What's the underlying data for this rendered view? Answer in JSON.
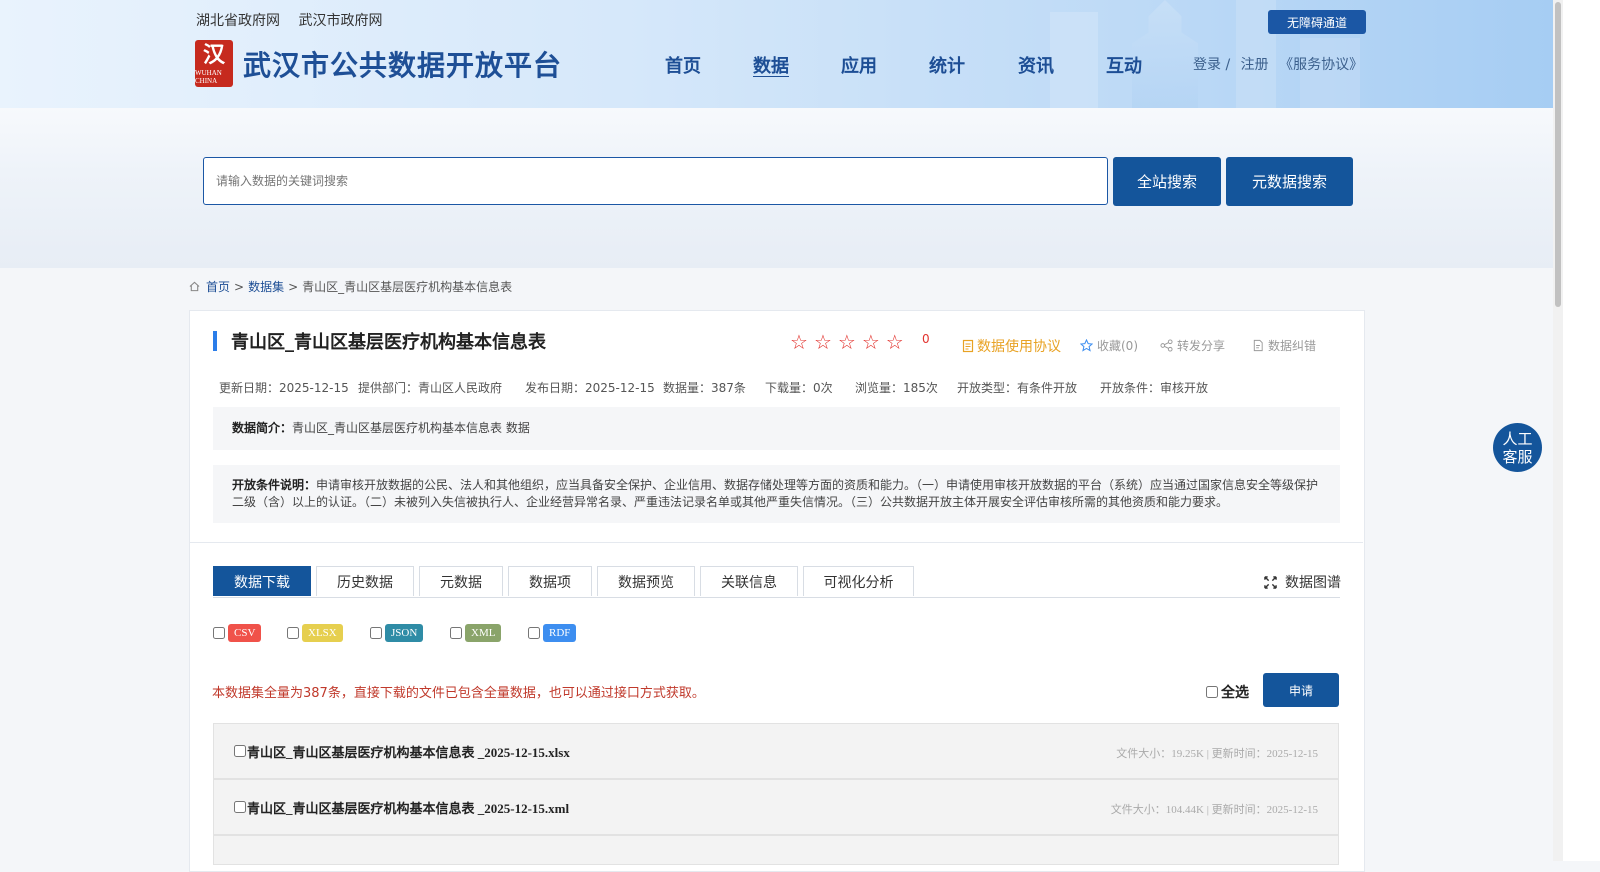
{
  "header": {
    "top_links": [
      "湖北省政府网",
      "武汉市政府网"
    ],
    "logo_text": "WUHAN CHINA",
    "site_title": "武汉市公共数据开放平台",
    "nav": [
      "首页",
      "数据",
      "应用",
      "统计",
      "资讯",
      "互动"
    ],
    "nav_active": "数据",
    "accessibility_button": "无障碍通道",
    "login": "登录 /",
    "register": "注册",
    "service_agreement": "《服务协议》"
  },
  "search": {
    "placeholder": "请输入数据的关键词搜索",
    "site_search": "全站搜索",
    "metadata_search": "元数据搜索"
  },
  "breadcrumb": {
    "home": "首页",
    "sep1": ">",
    "datasets": "数据集",
    "sep2": ">",
    "current": "青山区_青山区基层医疗机构基本信息表"
  },
  "dataset": {
    "title": "青山区_青山区基层医疗机构基本信息表",
    "rating": "0",
    "stars_total": 5,
    "usage_agreement": "数据使用协议",
    "favorite": "收藏(0)",
    "share": "转发分享",
    "report": "数据纠错",
    "meta": {
      "update_date": "更新日期：2025-12-15",
      "provider": "提供部门：青山区人民政府",
      "publish_date": "发布日期：2025-12-15",
      "data_count": "数据量：387条",
      "downloads": "下载量：0次",
      "views": "浏览量：185次",
      "open_type": "开放类型：有条件开放",
      "open_condition": "开放条件：审核开放"
    },
    "intro_label": "数据简介：",
    "intro_text": "青山区_青山区基层医疗机构基本信息表 数据",
    "condition_label": "开放条件说明：",
    "condition_text": "申请审核开放数据的公民、法人和其他组织，应当具备安全保护、企业信用、数据存储处理等方面的资质和能力。（一）申请使用审核开放数据的平台（系统）应当通过国家信息安全等级保护二级（含）以上的认证。（二）未被列入失信被执行人、企业经营异常名录、严重违法记录名单或其他严重失信情况。（三）公共数据开放主体开展安全评估审核所需的其他资质和能力要求。"
  },
  "tabs": [
    "数据下载",
    "历史数据",
    "元数据",
    "数据项",
    "数据预览",
    "关联信息",
    "可视化分析"
  ],
  "graph_link": "数据图谱",
  "formats": [
    {
      "label": "CSV",
      "color": "#f0524a"
    },
    {
      "label": "XLSX",
      "color": "#e6cf4f"
    },
    {
      "label": "JSON",
      "color": "#2f8ca6"
    },
    {
      "label": "XML",
      "color": "#8aa46a"
    },
    {
      "label": "RDF",
      "color": "#3d8ef0"
    }
  ],
  "download_note": "本数据集全量为387条，直接下载的文件已包含全量数据，也可以通过接口方式获取。",
  "select_all": "全选",
  "apply": "申请",
  "files": [
    {
      "name": "青山区_青山区基层医疗机构基本信息表 _2025-12-15.xlsx",
      "info": "文件大小：19.25K | 更新时间：2025-12-15"
    },
    {
      "name": "青山区_青山区基层医疗机构基本信息表 _2025-12-15.xml",
      "info": "文件大小：104.44K | 更新时间：2025-12-15"
    }
  ],
  "customer_service": "人工客服"
}
